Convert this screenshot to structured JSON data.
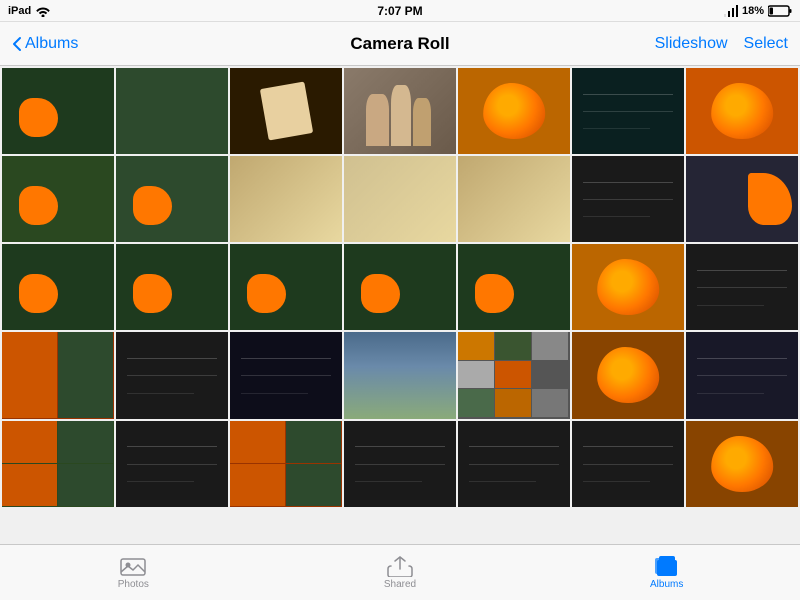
{
  "statusBar": {
    "carrier": "iPad",
    "time": "7:07 PM",
    "battery": "18%",
    "signal": "wifi"
  },
  "navBar": {
    "backLabel": "Albums",
    "title": "Camera Roll",
    "slideshowLabel": "Slideshow",
    "selectLabel": "Select"
  },
  "grid": {
    "columns": 7,
    "photos": [
      {
        "id": 1,
        "color": "green-dark",
        "hasOrange": true,
        "type": "green-orange"
      },
      {
        "id": 2,
        "color": "green-med",
        "hasOrange": false,
        "type": "green-flowers"
      },
      {
        "id": 3,
        "color": "brown",
        "hasOrange": false,
        "type": "selected-dark",
        "selected": true
      },
      {
        "id": 4,
        "color": "people",
        "hasOrange": false,
        "type": "people"
      },
      {
        "id": 5,
        "color": "orange-flower",
        "hasOrange": true,
        "type": "orange-flower"
      },
      {
        "id": 6,
        "color": "dark-teal",
        "hasOrange": false,
        "type": "dark-screen"
      },
      {
        "id": 7,
        "color": "orange-bright",
        "hasOrange": true,
        "type": "orange-bright"
      },
      {
        "id": 8,
        "color": "green-leaf",
        "hasOrange": true,
        "type": "green-orange"
      },
      {
        "id": 9,
        "color": "green-med",
        "hasOrange": true,
        "type": "green-orange"
      },
      {
        "id": 10,
        "color": "tan",
        "hasOrange": false,
        "type": "tan-screen"
      },
      {
        "id": 11,
        "color": "sand",
        "hasOrange": false,
        "type": "sand"
      },
      {
        "id": 12,
        "color": "tan",
        "hasOrange": false,
        "type": "tan-screen"
      },
      {
        "id": 13,
        "color": "dark-gray",
        "hasOrange": false,
        "type": "dark-screen"
      },
      {
        "id": 14,
        "color": "gray-screen",
        "hasOrange": true,
        "type": "screen-orange"
      },
      {
        "id": 15,
        "color": "green-dark",
        "hasOrange": true,
        "type": "green-orange"
      },
      {
        "id": 16,
        "color": "green-dark",
        "hasOrange": true,
        "type": "green-orange"
      },
      {
        "id": 17,
        "color": "green-dark",
        "hasOrange": true,
        "type": "green-orange"
      },
      {
        "id": 18,
        "color": "green-dark",
        "hasOrange": true,
        "type": "green-orange"
      },
      {
        "id": 19,
        "color": "green-dark",
        "hasOrange": true,
        "type": "green-orange"
      },
      {
        "id": 20,
        "color": "orange-flower",
        "hasOrange": true,
        "type": "orange-flower"
      },
      {
        "id": 21,
        "color": "dark-gray",
        "hasOrange": false,
        "type": "dark-screen"
      },
      {
        "id": 22,
        "color": "orange-collage",
        "hasOrange": true,
        "type": "orange-collage"
      },
      {
        "id": 23,
        "color": "dark-gray",
        "hasOrange": false,
        "type": "dark-screen"
      },
      {
        "id": 24,
        "color": "screen-dark",
        "hasOrange": false,
        "type": "software"
      },
      {
        "id": 25,
        "color": "mountain",
        "hasOrange": false,
        "type": "mountain"
      },
      {
        "id": 26,
        "color": "photo-grid",
        "hasOrange": false,
        "type": "photo-grid"
      },
      {
        "id": 27,
        "color": "orange-dark",
        "hasOrange": true,
        "type": "orange-dark"
      },
      {
        "id": 28,
        "color": "software",
        "hasOrange": false,
        "type": "software"
      },
      {
        "id": 29,
        "color": "green-leaf",
        "hasOrange": true,
        "type": "orange-collage"
      },
      {
        "id": 30,
        "color": "dark-gray",
        "hasOrange": false,
        "type": "dark-screen"
      },
      {
        "id": 31,
        "color": "orange-collage",
        "hasOrange": true,
        "type": "orange-collage"
      },
      {
        "id": 32,
        "color": "dark-gray",
        "hasOrange": false,
        "type": "dark-screen"
      },
      {
        "id": 33,
        "color": "dark-gray",
        "hasOrange": false,
        "type": "dark-screen"
      },
      {
        "id": 34,
        "color": "dark-gray",
        "hasOrange": false,
        "type": "dark-screen"
      },
      {
        "id": 35,
        "color": "orange-dark",
        "hasOrange": true,
        "type": "orange-dark"
      }
    ]
  },
  "tabBar": {
    "tabs": [
      {
        "id": "photos",
        "label": "Photos",
        "active": false
      },
      {
        "id": "shared",
        "label": "Shared",
        "active": false
      },
      {
        "id": "albums",
        "label": "Albums",
        "active": true
      }
    ]
  }
}
